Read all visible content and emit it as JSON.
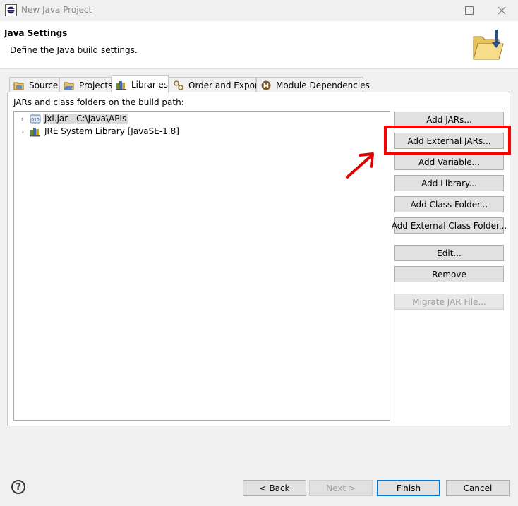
{
  "window": {
    "title": "New Java Project",
    "minimize_glyph": "☐",
    "maximize_glyph": "☐",
    "close_glyph": "✕"
  },
  "header": {
    "title": "Java Settings",
    "description": "Define the Java build settings."
  },
  "tabs": [
    {
      "label": "Source",
      "icon": "source-folder-icon",
      "active": false
    },
    {
      "label": "Projects",
      "icon": "projects-icon",
      "active": false
    },
    {
      "label": "Libraries",
      "icon": "libraries-icon",
      "active": true
    },
    {
      "label": "Order and Export",
      "icon": "order-export-icon",
      "active": false
    },
    {
      "label": "Module Dependencies",
      "icon": "module-icon",
      "active": false
    }
  ],
  "libraries": {
    "label": "JARs and class folders on the build path:",
    "entries": [
      {
        "label": "jxl.jar - C:\\Java\\APIs",
        "icon": "jar-icon",
        "selected": true
      },
      {
        "label": "JRE System Library [JavaSE-1.8]",
        "icon": "library-icon",
        "selected": false
      }
    ]
  },
  "buttons": {
    "add_jars": "Add JARs...",
    "add_external_jars": "Add External JARs...",
    "add_variable": "Add Variable...",
    "add_library": "Add Library...",
    "add_class_folder": "Add Class Folder...",
    "add_external_class_folder": "Add External Class Folder...",
    "edit": "Edit...",
    "remove": "Remove",
    "migrate_jar": "Migrate JAR File..."
  },
  "footer": {
    "help": "?",
    "back": "< Back",
    "next": "Next >",
    "finish": "Finish",
    "cancel": "Cancel"
  },
  "colors": {
    "highlight": "#ff0000",
    "default_button_border": "#0078d7"
  }
}
